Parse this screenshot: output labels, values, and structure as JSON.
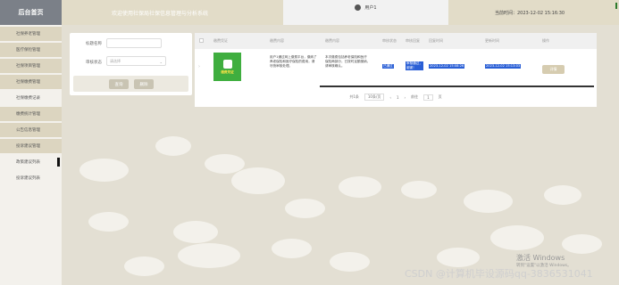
{
  "sidebar": {
    "title": "后台首页",
    "items": [
      {
        "label": "社保养老管理",
        "type": "group"
      },
      {
        "label": "医疗保险管理",
        "type": "group"
      },
      {
        "label": "社保项目管理",
        "type": "group"
      },
      {
        "label": "社保缴费管理",
        "type": "group"
      },
      {
        "label": "社保缴费记录",
        "type": "sub"
      },
      {
        "label": "缴费统计管理",
        "type": "group"
      },
      {
        "label": "公告信息管理",
        "type": "group"
      },
      {
        "label": "投诉建议管理",
        "type": "group"
      },
      {
        "label": "政策建议列表",
        "type": "sub-active"
      },
      {
        "label": "投诉建议列表",
        "type": "sub"
      }
    ]
  },
  "header": {
    "title": "欢迎使用社保局社保信息管理与分析系统",
    "user_label": "用户1",
    "time_label": "当前时间：2023-12-02 15:16:30"
  },
  "search": {
    "title_label": "标题名称",
    "title_placeholder": "",
    "status_label": "审核状态",
    "status_placeholder": "请选择",
    "query_button": "查询",
    "delete_button": "删除"
  },
  "table": {
    "headers": [
      "缴费凭证",
      "缴费内容",
      "缴费内容",
      "审核状态",
      "审核回复",
      "回复时间",
      "更新时间",
      "操作"
    ],
    "row": {
      "thumb_text": "缴费凭证",
      "content1_lines": [
        "用户1通过网上缴费平台，缴纳了",
        "养老保险和医疗保险的费用，请",
        "尽快审核处理。"
      ],
      "content2_lines": [
        "本次缴费包括养老保险和医疗",
        "保险两部分，已按时足额缴纳，",
        "请审核确认。"
      ],
      "status": "已通过",
      "reply_lines": [
        "审核通过，",
        "谢谢！"
      ],
      "reply_time": "2023-12-02 15:08:26",
      "update_time": "2023-12-02 15:13:03",
      "op_button": "详情"
    },
    "pagination": {
      "total": "共1条",
      "page_size": "10条/页",
      "prev": "‹",
      "page": "1",
      "next": "›",
      "goto_label": "前往",
      "goto_value": "1",
      "page_suffix": "页"
    }
  },
  "watermark": {
    "win_title": "激活 Windows",
    "win_sub": "转到\"设置\"以激活 Windows。",
    "csdn": "CSDN @计算机毕设源码qq-3836531041"
  }
}
